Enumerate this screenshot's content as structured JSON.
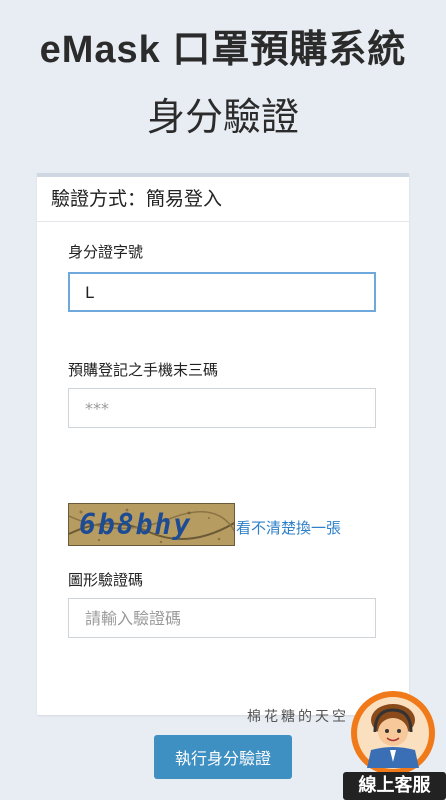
{
  "header": {
    "title": "eMask 口罩預購系統",
    "subtitle": "身分驗證"
  },
  "card": {
    "header": "驗證方式：簡易登入",
    "id_label": "身分證字號",
    "id_value": "L",
    "phone_label": "預購登記之手機末三碼",
    "phone_placeholder": "***",
    "captcha_text": "6b8bhy",
    "captcha_refresh": "看不清楚換一張",
    "captcha_label": "圖形驗證碼",
    "captcha_placeholder": "請輸入驗證碼"
  },
  "watermark": "棉花糖的天空",
  "submit_label": "執行身分驗證",
  "service_label": "線上客服",
  "colors": {
    "accent": "#3e8fc2",
    "link": "#2f80c8",
    "focus": "#6fa8dc",
    "background": "#e8edf3"
  }
}
